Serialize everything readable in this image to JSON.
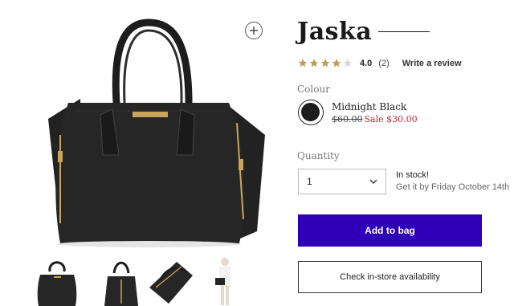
{
  "product": {
    "title": "Jaska",
    "rating_value": "4.0",
    "rating_count": "(2)",
    "rating_stars": 4,
    "write_review_label": "Write a review"
  },
  "colour": {
    "label": "Colour",
    "name": "Midnight Black",
    "swatch_color": "#1c1c1c",
    "old_price": "$60.00",
    "sale_label": "Sale $30.00"
  },
  "quantity": {
    "label": "Quantity",
    "selected": "1"
  },
  "stock": {
    "status": "In stock!",
    "delivery": "Get it by Friday October 14th"
  },
  "actions": {
    "add_to_bag": "Add to bag",
    "check_store": "Check in-store availability"
  },
  "colors": {
    "accent": "#2f00b8",
    "sale": "#d0202e",
    "star": "#b8a05a"
  },
  "icons": {
    "zoom": "plus-circle-icon",
    "select": "chevron-down-icon",
    "star": "star-icon"
  }
}
